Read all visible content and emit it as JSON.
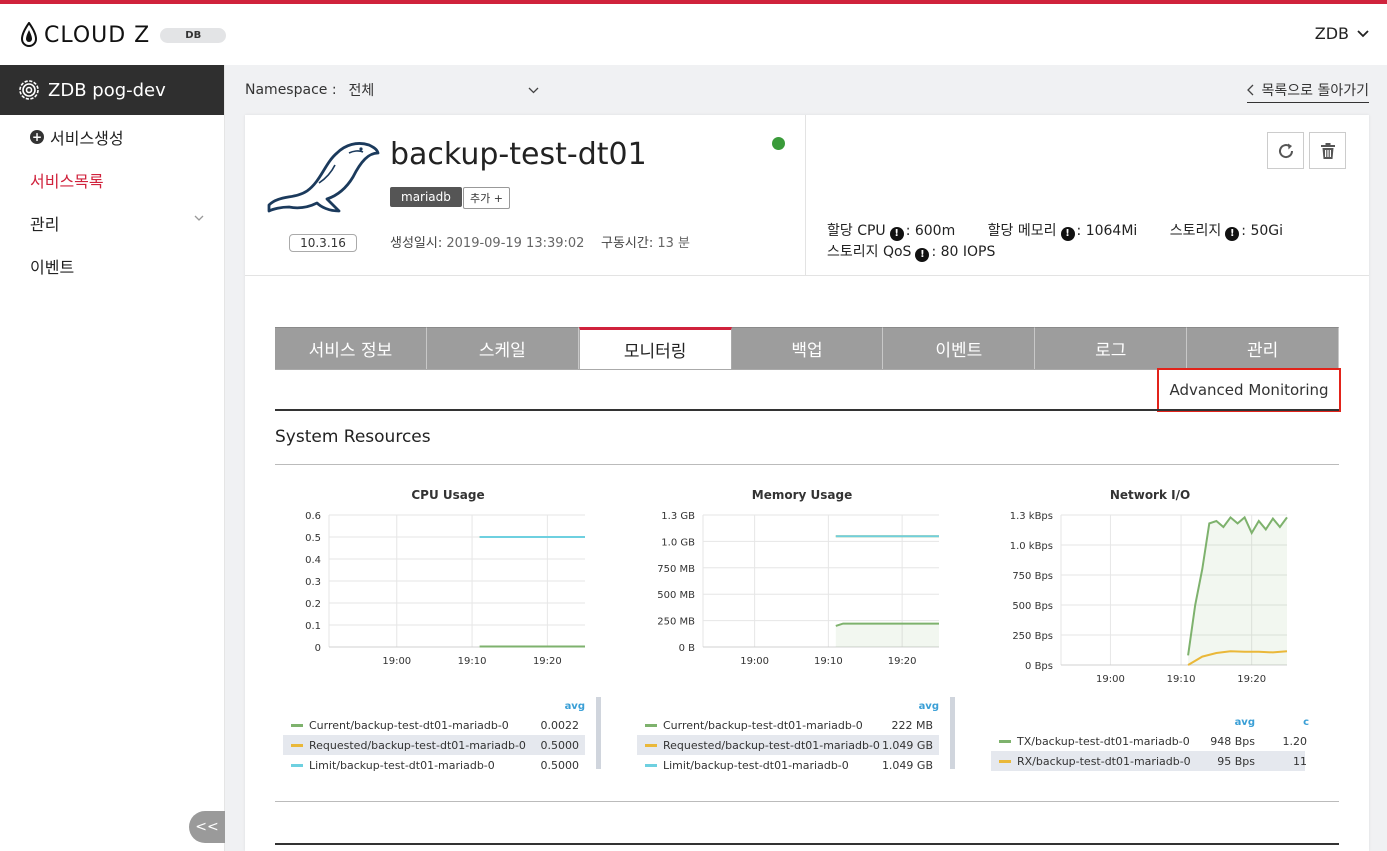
{
  "header": {
    "logo_text": "CLOUD Z",
    "logo_badge": "DB",
    "user_label": "ZDB"
  },
  "sidebar": {
    "title": "ZDB pog-dev",
    "items": [
      {
        "label": "서비스생성"
      },
      {
        "label": "서비스목록"
      },
      {
        "label": "관리"
      },
      {
        "label": "이벤트"
      }
    ],
    "collapse_label": "<<"
  },
  "toolbar": {
    "namespace_label": "Namespace :",
    "namespace_value": "전체",
    "back_label": "목록으로 돌아가기"
  },
  "service": {
    "name": "backup-test-dt01",
    "db_tag": "mariadb",
    "add_tag": "추가 +",
    "version": "10.3.16",
    "created_label": "생성일시:",
    "created_value": "2019-09-19 13:39:02",
    "uptime_label": "구동시간:",
    "uptime_value": "13 분",
    "status_color": "#3a9b3a",
    "alloc": {
      "cpu_label": "할당 CPU",
      "cpu_value": ": 600m",
      "mem_label": "할당 메모리",
      "mem_value": ": 1064Mi",
      "storage_label": "스토리지",
      "storage_value": ": 50Gi",
      "qos_label": "스토리지 QoS",
      "qos_value": ": 80 IOPS"
    }
  },
  "tabs": [
    {
      "label": "서비스 정보"
    },
    {
      "label": "스케일"
    },
    {
      "label": "모니터링"
    },
    {
      "label": "백업"
    },
    {
      "label": "이벤트"
    },
    {
      "label": "로그"
    },
    {
      "label": "관리"
    }
  ],
  "advanced_monitoring_label": "Advanced Monitoring",
  "section_title": "System Resources",
  "colors": {
    "accent": "#d0223c",
    "green": "#7eb26d",
    "yellow": "#eab839",
    "cyan": "#6ed0e0"
  },
  "chart_data": [
    {
      "type": "line",
      "title": "CPU Usage",
      "x_ticks": [
        "19:00",
        "19:10",
        "19:20"
      ],
      "y_ticks": [
        "0",
        "0.1",
        "0.2",
        "0.3",
        "0.4",
        "0.5",
        "0.6"
      ],
      "ylim": [
        0,
        0.6
      ],
      "xlim": [
        "18:51",
        "19:25"
      ],
      "series": [
        {
          "name": "Current/backup-test-dt01-mariadb-0",
          "color": "#7eb26d",
          "x": [
            "19:11",
            "19:25"
          ],
          "values": [
            0.0022,
            0.0022
          ],
          "avg": "0.0022"
        },
        {
          "name": "Requested/backup-test-dt01-mariadb-0",
          "color": "#eab839",
          "x": [
            "19:11",
            "19:25"
          ],
          "values": [
            0.5,
            0.5
          ],
          "avg": "0.5000"
        },
        {
          "name": "Limit/backup-test-dt01-mariadb-0",
          "color": "#6ed0e0",
          "x": [
            "19:11",
            "19:25"
          ],
          "values": [
            0.5,
            0.5
          ],
          "avg": "0.5000"
        }
      ],
      "legend_header": "avg"
    },
    {
      "type": "line",
      "title": "Memory Usage",
      "x_ticks": [
        "19:00",
        "19:10",
        "19:20"
      ],
      "y_ticks": [
        "0 B",
        "250 MB",
        "500 MB",
        "750 MB",
        "1.0 GB",
        "1.3 GB"
      ],
      "ylim": [
        0,
        1.25
      ],
      "xlim": [
        "18:53",
        "19:25"
      ],
      "series": [
        {
          "name": "Current/backup-test-dt01-mariadb-0",
          "color": "#7eb26d",
          "x": [
            "19:11",
            "19:12",
            "19:25"
          ],
          "values": [
            0.2,
            0.222,
            0.222
          ],
          "avg": "222 MB"
        },
        {
          "name": "Requested/backup-test-dt01-mariadb-0",
          "color": "#eab839",
          "x": [
            "19:11",
            "19:25"
          ],
          "values": [
            1.049,
            1.049
          ],
          "avg": "1.049 GB"
        },
        {
          "name": "Limit/backup-test-dt01-mariadb-0",
          "color": "#6ed0e0",
          "x": [
            "19:11",
            "19:25"
          ],
          "values": [
            1.049,
            1.049
          ],
          "avg": "1.049 GB"
        }
      ],
      "legend_header": "avg"
    },
    {
      "type": "area",
      "title": "Network I/O",
      "x_ticks": [
        "19:00",
        "19:10",
        "19:20"
      ],
      "y_ticks": [
        "0 Bps",
        "250 Bps",
        "500 Bps",
        "750 Bps",
        "1.0 kBps",
        "1.3 kBps"
      ],
      "ylim": [
        0,
        1250
      ],
      "xlim": [
        "18:53",
        "19:25"
      ],
      "series": [
        {
          "name": "TX/backup-test-dt01-mariadb-0",
          "color": "#7eb26d",
          "x": [
            "19:11",
            "19:12",
            "19:13",
            "19:14",
            "19:15",
            "19:16",
            "19:17",
            "19:18",
            "19:19",
            "19:20",
            "19:21",
            "19:22",
            "19:23",
            "19:24",
            "19:25"
          ],
          "values": [
            80,
            500,
            800,
            1180,
            1200,
            1150,
            1230,
            1180,
            1230,
            1100,
            1200,
            1130,
            1220,
            1150,
            1230
          ],
          "avg": "948 Bps",
          "current": "1.20"
        },
        {
          "name": "RX/backup-test-dt01-mariadb-0",
          "color": "#eab839",
          "x": [
            "19:11",
            "19:13",
            "19:15",
            "19:17",
            "19:19",
            "19:21",
            "19:23",
            "19:25"
          ],
          "values": [
            0,
            70,
            100,
            115,
            110,
            110,
            105,
            115
          ],
          "avg": "95 Bps",
          "current": "11"
        }
      ],
      "legend_header": "avg",
      "legend_header2": "c"
    }
  ]
}
